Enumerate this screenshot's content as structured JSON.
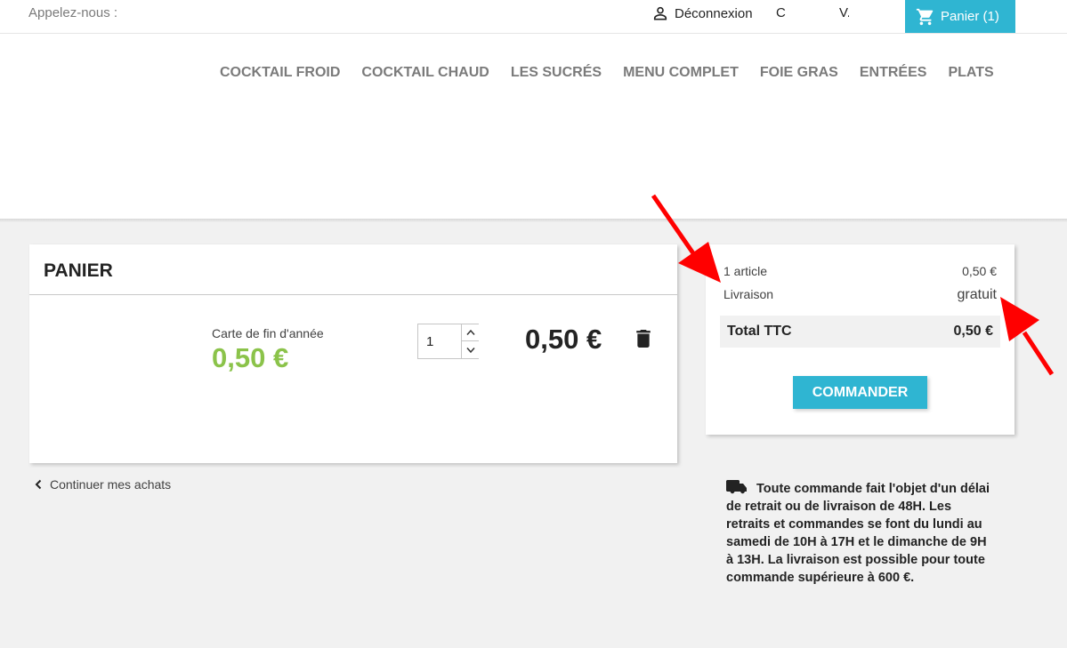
{
  "topbar": {
    "call_label": "Appelez-nous :",
    "logout_label": "Déconnexion",
    "truncated_1": "C",
    "truncated_2": "V.",
    "cart_label": "Panier (1)"
  },
  "nav": {
    "items": [
      "Cocktail froid",
      "Cocktail chaud",
      "Les sucrés",
      "Menu complet",
      "Foie gras",
      "Entrées",
      "Plats"
    ]
  },
  "cart": {
    "title": "Panier",
    "product": {
      "name": "Carte de fin d'année",
      "unit_price": "0,50 €",
      "quantity": "1",
      "line_total": "0,50 €"
    },
    "continue_label": "Continuer mes achats"
  },
  "summary": {
    "items_label": "1 article",
    "items_value": "0,50 €",
    "shipping_label": "Livraison",
    "shipping_value": "gratuit",
    "total_label": "Total TTC",
    "total_value": "0,50 €",
    "order_button": "Commander"
  },
  "notice": {
    "text": "Toute commande fait l'objet d'un délai de retrait ou de livraison de 48H. Les retraits et commandes se font du lundi au samedi de 10H à 17H et le dimanche de 9H à 13H. La livraison est possible pour toute commande supérieure à 600 €."
  },
  "colors": {
    "accent": "#2fb5d2",
    "price_green": "#8bc34a",
    "annotation_red": "#ff0000"
  }
}
